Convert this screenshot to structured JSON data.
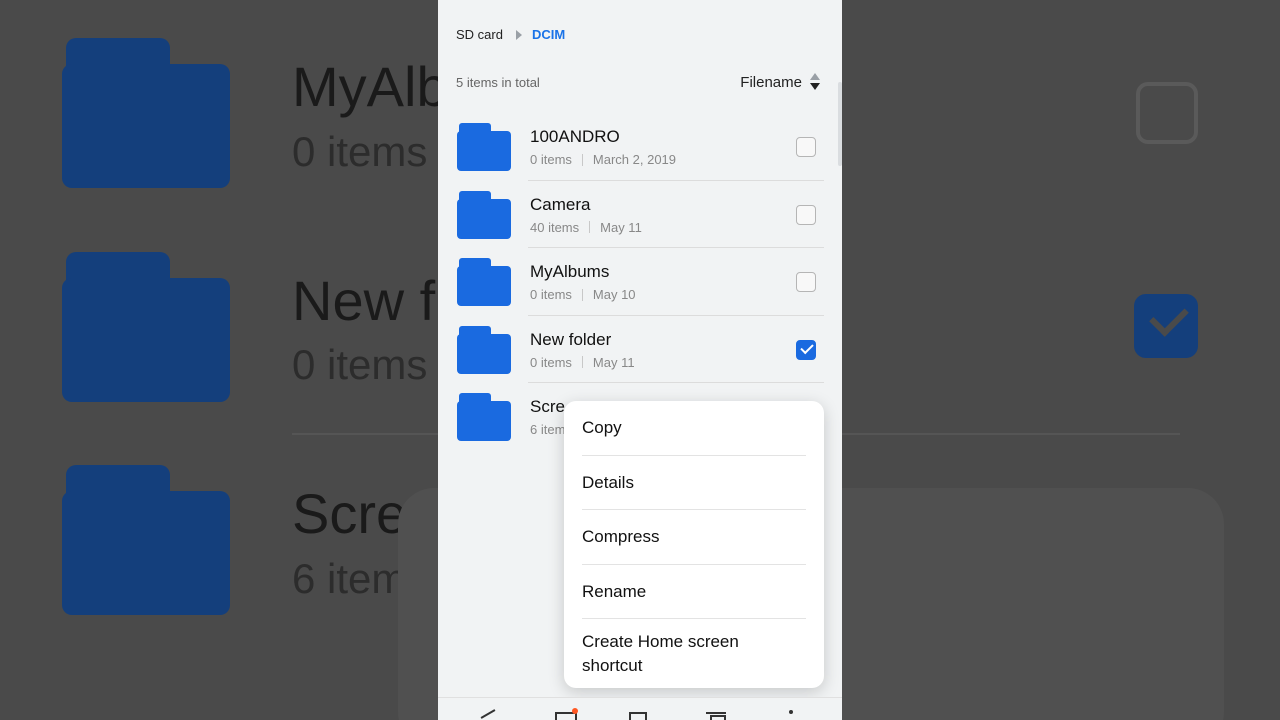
{
  "breadcrumb": {
    "root": "SD card",
    "current": "DCIM"
  },
  "summary": {
    "count": "5 items in total",
    "sort_label": "Filename"
  },
  "folders": [
    {
      "name": "100ANDRO",
      "items": "0 items",
      "date": "March 2, 2019",
      "checked": false
    },
    {
      "name": "Camera",
      "items": "40 items",
      "date": "May 11",
      "checked": false
    },
    {
      "name": "MyAlbums",
      "items": "0 items",
      "date": "May 10",
      "checked": false
    },
    {
      "name": "New folder",
      "items": "0 items",
      "date": "May 11",
      "checked": true
    },
    {
      "name": "Scre",
      "items": "6 item",
      "date": "",
      "checked": false
    }
  ],
  "menu": {
    "copy": "Copy",
    "details": "Details",
    "compress": "Compress",
    "rename": "Rename",
    "shortcut_line1": "Create Home screen",
    "shortcut_line2": "shortcut"
  },
  "background": {
    "name1": "MyAlb",
    "sub1": "0 items",
    "name2": "New f",
    "sub2": "0 items",
    "name3": "Scre",
    "sub3": "6 item"
  },
  "colors": {
    "accent": "#1a73e8",
    "folder": "#1a6ae0",
    "badge": "#ff5722"
  }
}
